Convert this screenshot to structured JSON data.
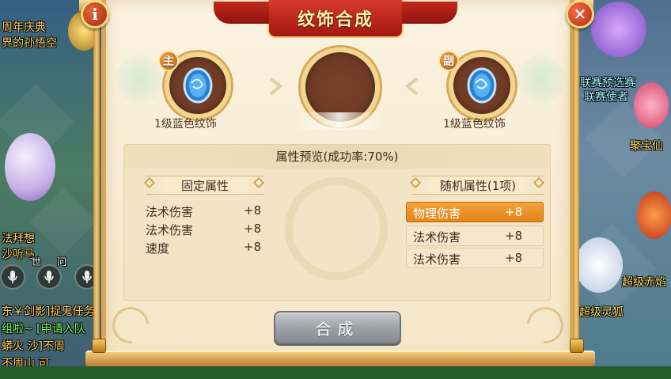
{
  "title": "纹饰合成",
  "buttons": {
    "info": "i",
    "close": "✕",
    "compose": "合成"
  },
  "slots": {
    "main_badge": "主",
    "sub_badge": "副",
    "main_label": "1级蓝色纹饰",
    "sub_label": "1级蓝色纹饰"
  },
  "preview": {
    "header": "属性预览(成功率:70%)",
    "fixed_title": "固定属性",
    "random_title": "随机属性(1项)",
    "fixed_attrs": [
      {
        "name": "法术伤害",
        "value": "+8"
      },
      {
        "name": "法术伤害",
        "value": "+8"
      },
      {
        "name": "速度",
        "value": "+8"
      }
    ],
    "random_attrs": [
      {
        "name": "物理伤害",
        "value": "+8",
        "selected": true
      },
      {
        "name": "法术伤害",
        "value": "+8",
        "selected": false
      },
      {
        "name": "法术伤害",
        "value": "+8",
        "selected": false
      }
    ]
  },
  "background": {
    "chat_lines": [
      "周年庆典",
      "界的孙悟空",
      "法拜想",
      "沙听马",
      "世",
      "问",
      "东￥剑影]捉鬼任务",
      "组啦~ [申请入队",
      "蟒火 沙]不周",
      "不周山 可"
    ],
    "npc_labels": [
      "联赛预选赛",
      "联赛使者",
      "聚宝仙",
      "超级赤焰",
      "超级灵狐"
    ]
  },
  "colors": {
    "accent_orange": "#e28419",
    "title_red": "#b72a14",
    "panel_bg": "#f5e7c7",
    "text_dark": "#3b2d1e"
  },
  "icons": {
    "info": "info-icon",
    "close": "close-icon",
    "gem": "blue-ornament-gem-icon",
    "arrow": "merge-arrow-icon",
    "voice": "microphone-icon"
  }
}
